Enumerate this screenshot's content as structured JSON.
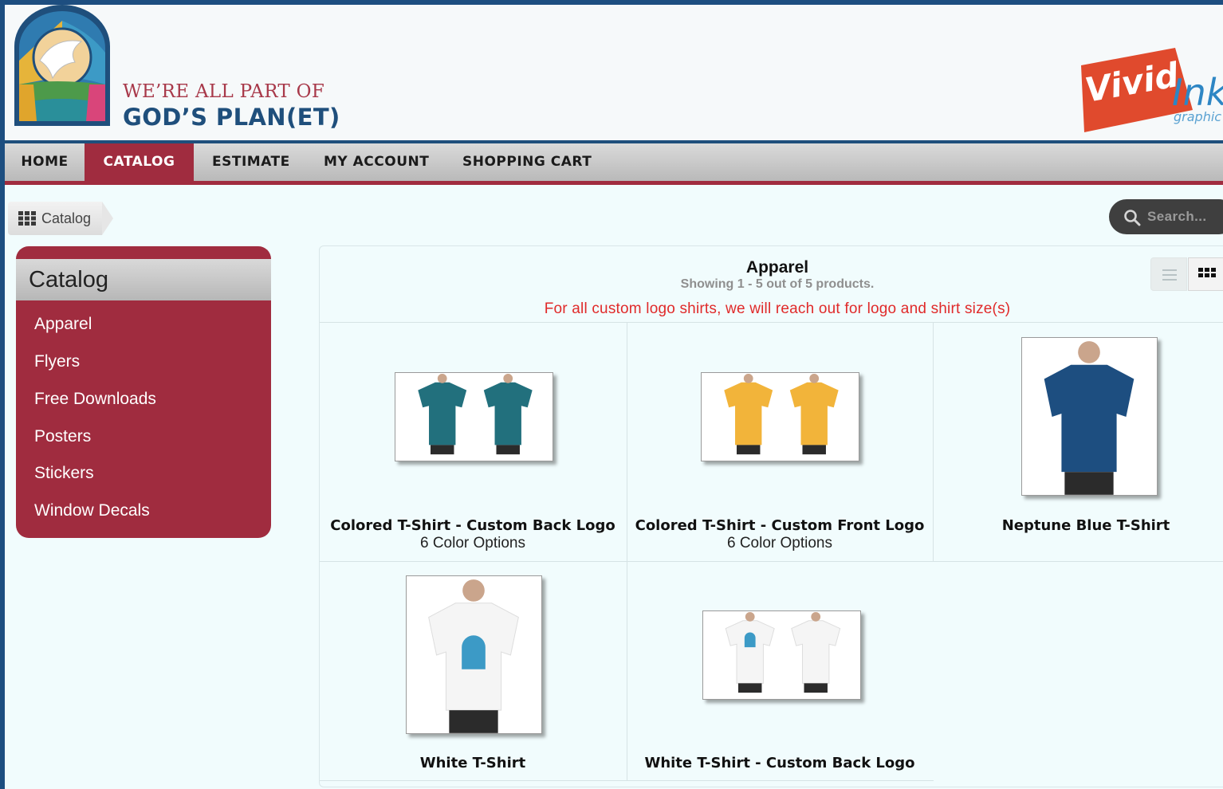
{
  "header": {
    "tagline_line1": "WE’RE ALL PART OF",
    "tagline_line2": "GOD’S PLAN(ET)",
    "partner_logo_text": "VividInk",
    "partner_logo_sub": "graphic",
    "brand_color": "#a02c3f",
    "navy_color": "#1f4f7c"
  },
  "nav": {
    "items": [
      {
        "label": "HOME",
        "active": false
      },
      {
        "label": "CATALOG",
        "active": true
      },
      {
        "label": "ESTIMATE",
        "active": false
      },
      {
        "label": "MY ACCOUNT",
        "active": false
      },
      {
        "label": "SHOPPING CART",
        "active": false
      }
    ]
  },
  "breadcrumb": {
    "icon": "grid-icon",
    "label": "Catalog"
  },
  "search": {
    "placeholder": "Search..."
  },
  "sidebar": {
    "title": "Catalog",
    "items": [
      "Apparel",
      "Flyers",
      "Free Downloads",
      "Posters",
      "Stickers",
      "Window Decals"
    ]
  },
  "category": {
    "title": "Apparel",
    "count": "Showing 1 - 5 out of 5 products.",
    "note": "For all custom logo shirts, we will reach out for logo and shirt size(s)",
    "view_modes": [
      "list-view-icon",
      "grid-view-icon"
    ]
  },
  "products": [
    {
      "name": "Colored T-Shirt - Custom Back Logo",
      "sub": "6 Color Options",
      "shirt_color": "#22707d"
    },
    {
      "name": "Colored T-Shirt - Custom Front Logo",
      "sub": "6 Color Options",
      "shirt_color": "#f2b43a"
    },
    {
      "name": "Neptune Blue T-Shirt",
      "sub": "",
      "shirt_color": "#1d4e80"
    },
    {
      "name": "White T-Shirt",
      "sub": "",
      "shirt_color": "#f5f5f5"
    },
    {
      "name": "White T-Shirt - Custom Back Logo",
      "sub": "",
      "shirt_color": "#f5f5f5"
    }
  ]
}
